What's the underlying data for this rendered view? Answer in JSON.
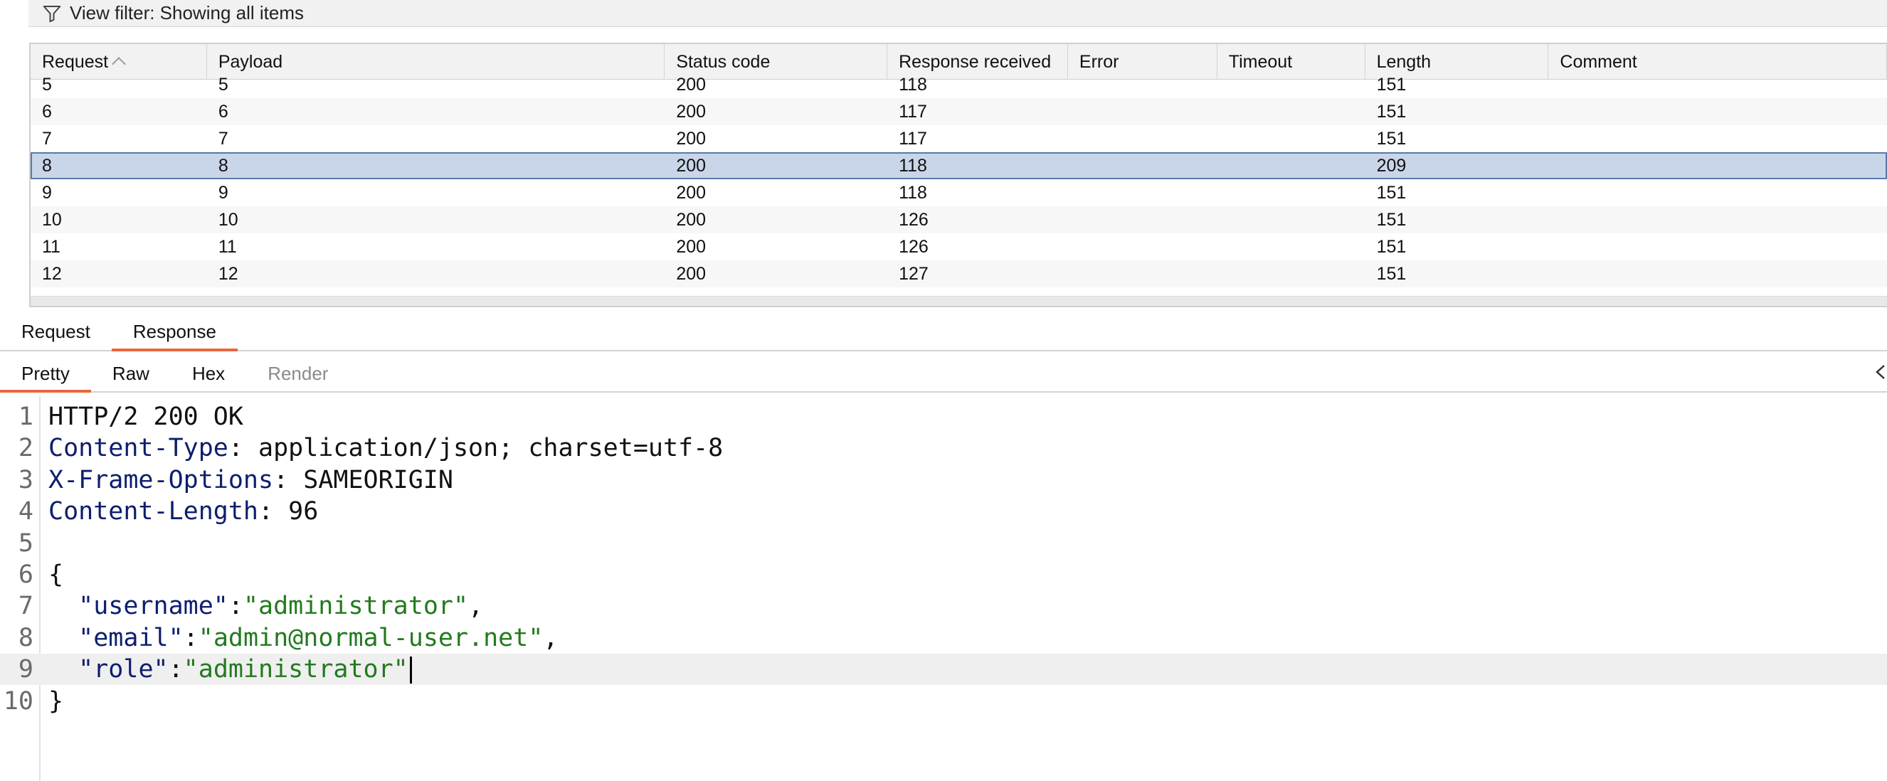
{
  "filter": {
    "label": "View filter: Showing all items"
  },
  "table": {
    "columns": [
      "Request",
      "Payload",
      "Status code",
      "Response received",
      "Error",
      "Timeout",
      "Length",
      "Comment"
    ],
    "rows": [
      [
        "5",
        "5",
        "200",
        "118",
        "",
        "",
        "151",
        ""
      ],
      [
        "6",
        "6",
        "200",
        "117",
        "",
        "",
        "151",
        ""
      ],
      [
        "7",
        "7",
        "200",
        "117",
        "",
        "",
        "151",
        ""
      ],
      [
        "8",
        "8",
        "200",
        "118",
        "",
        "",
        "209",
        ""
      ],
      [
        "9",
        "9",
        "200",
        "118",
        "",
        "",
        "151",
        ""
      ],
      [
        "10",
        "10",
        "200",
        "126",
        "",
        "",
        "151",
        ""
      ],
      [
        "11",
        "11",
        "200",
        "126",
        "",
        "",
        "151",
        ""
      ],
      [
        "12",
        "12",
        "200",
        "127",
        "",
        "",
        "151",
        ""
      ]
    ],
    "selected_row": "8",
    "sort_column": "Request"
  },
  "message_tabs": [
    {
      "label": "Request",
      "active": false
    },
    {
      "label": "Response",
      "active": true
    }
  ],
  "view_tabs": [
    {
      "label": "Pretty",
      "active": true
    },
    {
      "label": "Raw",
      "active": false
    },
    {
      "label": "Hex",
      "active": false
    },
    {
      "label": "Render",
      "active": false,
      "disabled": true
    }
  ],
  "editor": {
    "line_numbers": [
      "1",
      "2",
      "3",
      "4",
      "5",
      "6",
      "7",
      "8",
      "9",
      "10"
    ],
    "status_line": "HTTP/2 200 OK",
    "headers": [
      {
        "name": "Content-Type",
        "value": "application/json; charset=utf-8"
      },
      {
        "name": "X-Frame-Options",
        "value": "SAMEORIGIN"
      },
      {
        "name": "Content-Length",
        "value": "96"
      }
    ],
    "open_brace": "{",
    "fields": [
      {
        "key": "\"username\"",
        "value": "\"administrator\"",
        "sep": ","
      },
      {
        "key": "\"email\"",
        "value": "\"admin@normal-user.net\"",
        "sep": ","
      },
      {
        "key": "\"role\"",
        "value": "\"administrator\"",
        "sep": ""
      }
    ],
    "close_brace": "}",
    "current_line": "9"
  },
  "colors": {
    "accent": "#e8663d",
    "selection": "#c9d6ea",
    "header_name": "#0d1e6e",
    "json_string": "#237a1e"
  },
  "icons": {
    "filter": "funnel-icon",
    "collapse": "chevron-icon"
  }
}
